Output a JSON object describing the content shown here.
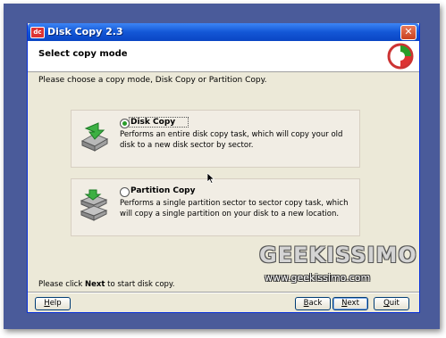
{
  "window": {
    "title": "Disk Copy 2.3",
    "close_glyph": "✕",
    "app_icon_text": "dc"
  },
  "header": {
    "title": "Select copy mode",
    "logo_icon": "app-logo-icon"
  },
  "instruction": "Please choose a copy mode, Disk Copy or Partition Copy.",
  "options": [
    {
      "label": "Disk Copy",
      "description": "Performs an entire disk copy task, which will copy your old disk to a new disk sector by sector.",
      "selected": true,
      "icon": "disk-copy-icon"
    },
    {
      "label": "Partition Copy",
      "description": "Performs a single partition sector to sector copy task, which will copy a single partition on your disk to a new location.",
      "selected": false,
      "icon": "partition-copy-icon"
    }
  ],
  "footer": {
    "prefix": "Please click ",
    "bold": "Next",
    "suffix": " to start disk copy."
  },
  "buttons": {
    "help": {
      "first": "H",
      "rest": "elp"
    },
    "back": {
      "first": "B",
      "rest": "ack"
    },
    "next": {
      "first": "N",
      "rest": "ext"
    },
    "quit": {
      "first": "Q",
      "rest": "uit"
    }
  },
  "watermark": {
    "brand": "GEEKISSIMO",
    "url": "www.geekissimo.com"
  },
  "colors": {
    "titlebar": "#1357d6",
    "window_bg": "#ece9d8",
    "desktop": "#4a5b9a",
    "radio_selected": "#2a9d2a"
  }
}
